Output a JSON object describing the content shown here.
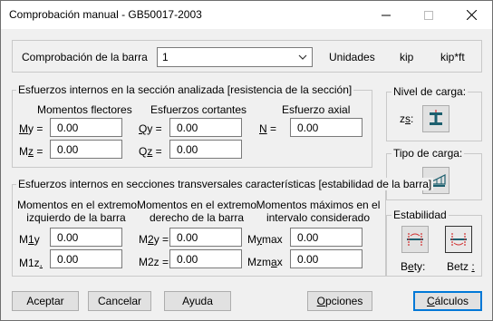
{
  "window": {
    "title": "Comprobación manual - GB50017-2003"
  },
  "header": {
    "bar_label": "Comprobación de la barra",
    "bar_value": "1",
    "units_label": "Unidades",
    "unit_force": "kip",
    "unit_moment": "kip*ft"
  },
  "internal_forces": {
    "legend": "Esfuerzos internos en la sección analizada [resistencia de la sección]",
    "bending_title": "Momentos flectores",
    "shear_title": "Esfuerzos cortantes",
    "axial_title": "Esfuerzo axial",
    "my_label_key": "M",
    "my_label_rest": "y =",
    "my_value": "0.00",
    "mz_label_pre": "M",
    "mz_label_key": "z",
    "mz_label_rest": " =",
    "mz_value": "0.00",
    "qy_label_key": "Q",
    "qy_label_rest": "y =",
    "qy_value": "0.00",
    "qz_label_pre": "Q",
    "qz_label_key": "z",
    "qz_label_rest": " =",
    "qz_value": "0.00",
    "n_label_key": "N",
    "n_label_rest": " =",
    "n_value": "0.00"
  },
  "load_level": {
    "legend": "Nivel de carga:",
    "zs_label_pre": "z",
    "zs_label_key": "s",
    "zs_label_rest": ":"
  },
  "load_type": {
    "legend": "Tipo de carga:"
  },
  "stability_forces": {
    "legend": "Esfuerzos internos en secciones transversales características [estabilidad de la barra]",
    "left_title_1": "Momentos en el extremo",
    "left_title_2": "izquierdo de la barra",
    "right_title_1": "Momentos en el extremo",
    "right_title_2": "derecho de la barra",
    "max_title_1": "Momentos máximos en el",
    "max_title_2": "intervalo considerado",
    "m1y_pre": "M",
    "m1y_key": "1",
    "m1y_rest": "y",
    "m1y_value": "0.00",
    "m1z_pre": "M1z",
    "m1z_key": ".",
    "m1z_value": "0.00",
    "m2y_pre": "M",
    "m2y_key": "2",
    "m2y_rest": "y =",
    "m2y_value": "0.00",
    "m2z_label": "M2z =",
    "m2z_value": "0.00",
    "mymax_pre": "M",
    "mymax_key": "y",
    "mymax_rest": "max",
    "mymax_value": "0.00",
    "mzmax_pre": "Mzm",
    "mzmax_key": "a",
    "mzmax_rest": "x",
    "mzmax_value": "0.00"
  },
  "stability": {
    "legend": "Estabilidad",
    "bety_pre": "B",
    "bety_key": "e",
    "bety_rest": "ty:",
    "betz_pre": "Betz ",
    "betz_key": ":"
  },
  "footer": {
    "accept": "Aceptar",
    "cancel": "Cancelar",
    "help": "Ayuda",
    "options_key": "O",
    "options_rest": "pciones",
    "calc_key": "C",
    "calc_rest": "álculos"
  },
  "colors": {
    "accent": "#0078d7",
    "icon_teal": "#1d5f6e",
    "icon_red": "#d03030"
  }
}
